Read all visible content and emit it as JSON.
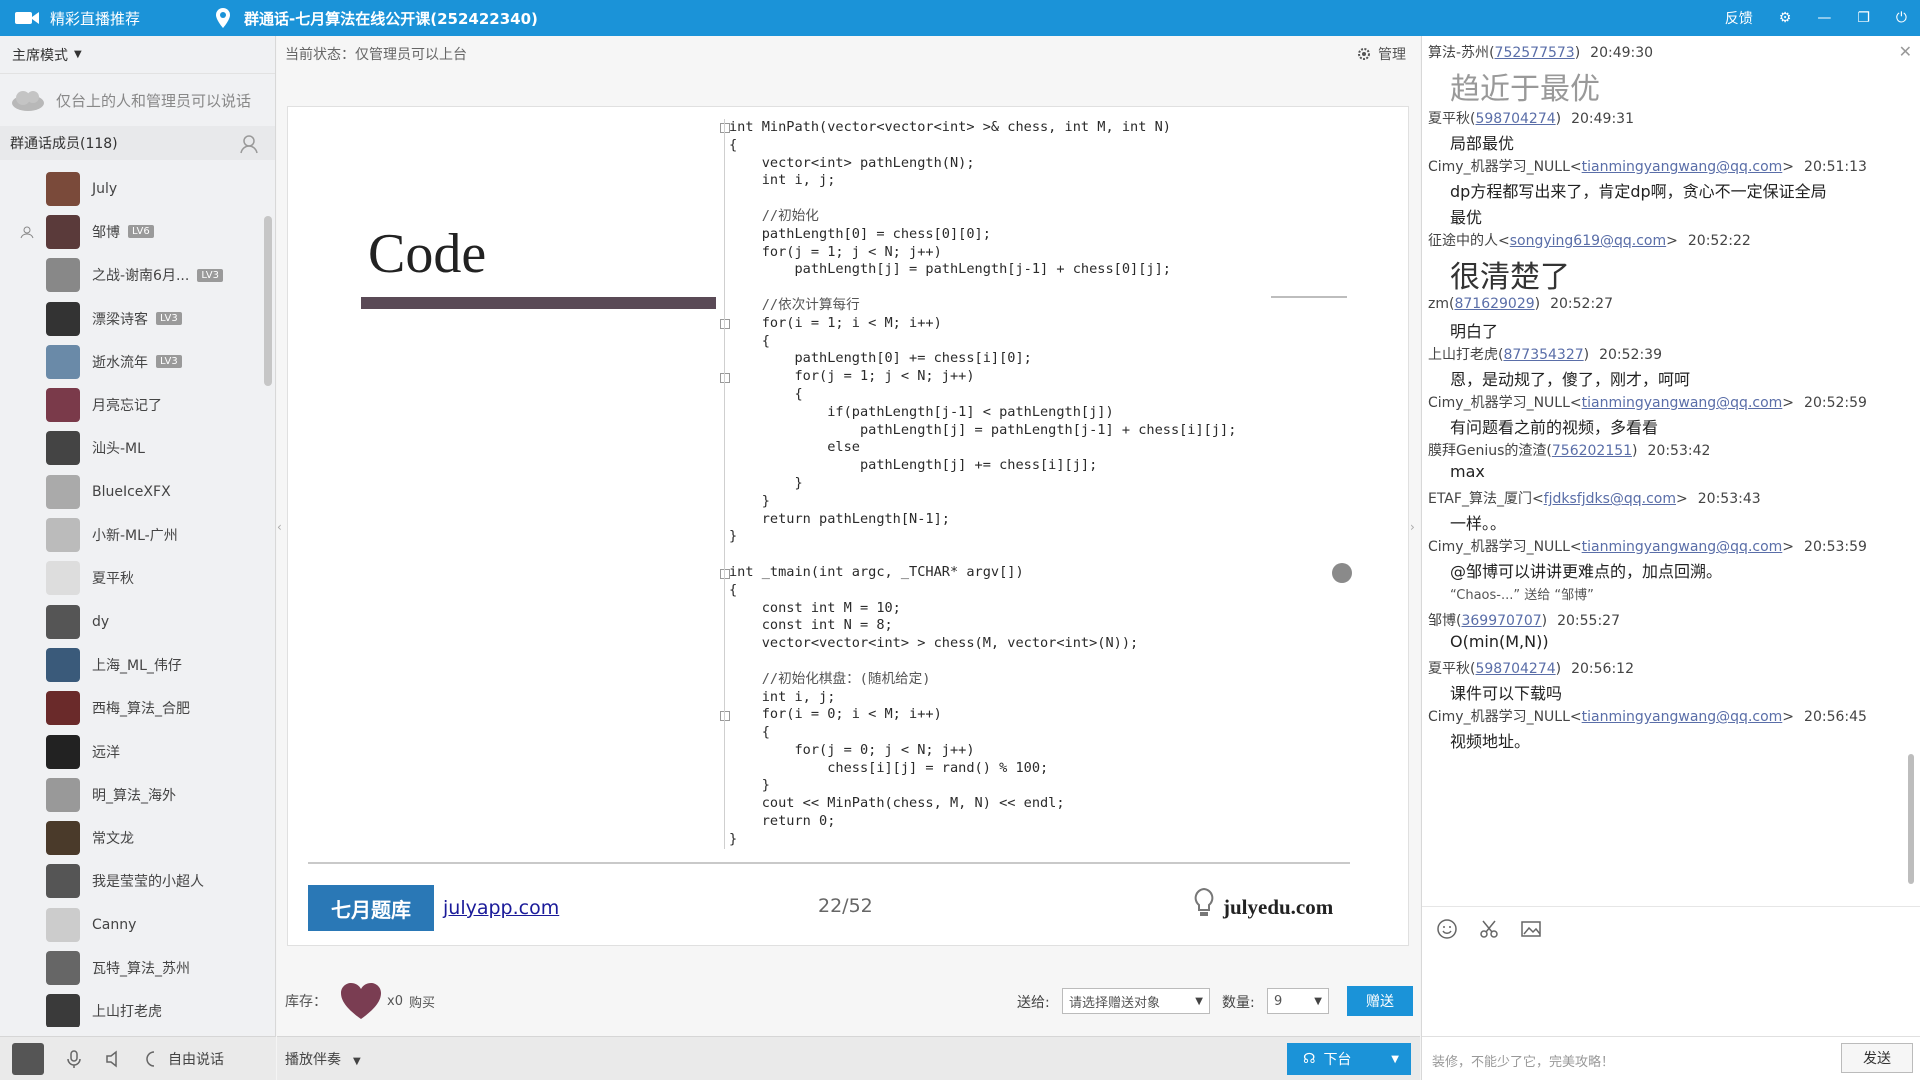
{
  "titlebar": {
    "app_label": "精彩直播推荐",
    "group_title": "群通话-七月算法在线公开课(252422340)",
    "feedback": "反馈",
    "controls": [
      "—",
      "❐",
      "⏻"
    ]
  },
  "left": {
    "mode": "主席模式",
    "notice": "仅台上的人和管理员可以说话",
    "members_header": "群通话成员(118)",
    "members": [
      {
        "name": "July",
        "badge": "",
        "color": "#7a4a3a"
      },
      {
        "name": "邹博",
        "badge": "LV6",
        "color": "#5a3a3a"
      },
      {
        "name": "之战-谢南6月...",
        "badge": "LV3",
        "color": "#888"
      },
      {
        "name": "漂梁诗客",
        "badge": "LV3",
        "color": "#333"
      },
      {
        "name": "逝水流年",
        "badge": "LV3",
        "color": "#6a8aa8"
      },
      {
        "name": "月亮忘记了",
        "badge": "",
        "color": "#7a3a4a"
      },
      {
        "name": "汕头-ML",
        "badge": "",
        "color": "#444"
      },
      {
        "name": "BlueIceXFX",
        "badge": "",
        "color": "#aaa"
      },
      {
        "name": "小新-ML-广州",
        "badge": "",
        "color": "#bbb"
      },
      {
        "name": "夏平秋",
        "badge": "",
        "color": "#ddd"
      },
      {
        "name": "dy",
        "badge": "",
        "color": "#555"
      },
      {
        "name": "上海_ML_伟仔",
        "badge": "",
        "color": "#3a5a7a"
      },
      {
        "name": "西梅_算法_合肥",
        "badge": "",
        "color": "#6a2a2a"
      },
      {
        "name": "远洋",
        "badge": "",
        "color": "#222"
      },
      {
        "name": "明_算法_海外",
        "badge": "",
        "color": "#999"
      },
      {
        "name": "常文龙",
        "badge": "",
        "color": "#4a3a2a"
      },
      {
        "name": "我是莹莹的小超人",
        "badge": "",
        "color": "#555"
      },
      {
        "name": "Canny",
        "badge": "",
        "color": "#ccc"
      },
      {
        "name": "瓦特_算法_苏州",
        "badge": "",
        "color": "#666"
      },
      {
        "name": "上山打老虎",
        "badge": "",
        "color": "#3a3a3a"
      }
    ],
    "bottom_free_talk": "自由说话"
  },
  "middle": {
    "status": "当前状态：仅管理员可以上台",
    "manage": "管理",
    "slide": {
      "title": "Code",
      "code_lines": [
        "int MinPath(vector<vector<int> >& chess, int M, int N)",
        "{",
        "    vector<int> pathLength(N);",
        "    int i, j;",
        "",
        "    //初始化",
        "    pathLength[0] = chess[0][0];",
        "    for(j = 1; j < N; j++)",
        "        pathLength[j] = pathLength[j-1] + chess[0][j];",
        "",
        "    //依次计算每行",
        "    for(i = 1; i < M; i++)",
        "    {",
        "        pathLength[0] += chess[i][0];",
        "        for(j = 1; j < N; j++)",
        "        {",
        "            if(pathLength[j-1] < pathLength[j])",
        "                pathLength[j] = pathLength[j-1] + chess[i][j];",
        "            else",
        "                pathLength[j] += chess[i][j];",
        "        }",
        "    }",
        "    return pathLength[N-1];",
        "}",
        "",
        "int _tmain(int argc, _TCHAR* argv[])",
        "{",
        "    const int M = 10;",
        "    const int N = 8;",
        "    vector<vector<int> > chess(M, vector<int>(N));",
        "",
        "    //初始化棋盘：(随机给定)",
        "    int i, j;",
        "    for(i = 0; i < M; i++)",
        "    {",
        "        for(j = 0; j < N; j++)",
        "            chess[i][j] = rand() % 100;",
        "    }",
        "    cout << MinPath(chess, M, N) << endl;",
        "    return 0;",
        "}"
      ],
      "logo_text": "七月题库",
      "july_link": "julyapp.com",
      "page": "22/52",
      "edu_link": "julyedu.com"
    },
    "gift": {
      "stock_label": "库存：",
      "count": "x0",
      "buy": "购买",
      "send_to_label": "送给:",
      "send_to_placeholder": "请选择赠送对象",
      "qty_label": "数量:",
      "qty_value": "9",
      "give_button": "赠送"
    },
    "bottom": {
      "bgm": "播放伴奏",
      "down_button": "下台"
    }
  },
  "chat": {
    "messages": [
      {
        "user": "算法-苏州",
        "uid": "752577573",
        "time": "20:49:30",
        "text": "趋近于最优",
        "big": true
      },
      {
        "user": "夏平秋",
        "uid": "598704274",
        "time": "20:49:31",
        "text": "局部最优"
      },
      {
        "user": "Cimy_机器学习_NULL<",
        "uid": "tianmingyangwang@qq.com",
        "suffix": ">",
        "time": "20:51:13",
        "text": "dp方程都写出来了，肯定dp啊，贪心不一定保证全局",
        "text2": "最优"
      },
      {
        "user": "征途中的人<",
        "uid": "songying619@qq.com",
        "suffix": ">",
        "time": "20:52:22",
        "text": "很清楚了",
        "big": true
      },
      {
        "user": "zm",
        "uid": "871629029",
        "time": "20:52:27",
        "text": "明白了"
      },
      {
        "user": "上山打老虎",
        "uid": "877354327",
        "time": "20:52:39",
        "text": "恩，是动规了，傻了，刚才，呵呵"
      },
      {
        "user": "Cimy_机器学习_NULL<",
        "uid": "tianmingyangwang@qq.com",
        "suffix": ">",
        "time": "20:52:59",
        "text": "有问题看之前的视频，多看看"
      },
      {
        "user": "膜拜Genius的渣渣",
        "uid": "756202151",
        "time": "20:53:42",
        "text": "max"
      },
      {
        "user": "ETAF_算法_厦门<",
        "uid": "fjdksfjdks@qq.com",
        "suffix": ">",
        "time": "20:53:43",
        "text": "一样。。"
      },
      {
        "user": "Cimy_机器学习_NULL<",
        "uid": "tianmingyangwang@qq.com",
        "suffix": ">",
        "time": "20:53:59",
        "text": "@邹博可以讲讲更难点的，加点回溯。"
      },
      {
        "user": "",
        "uid": "",
        "time": "",
        "text": "“Chaos-...” 送给 “邹博”",
        "gift": true
      },
      {
        "user": "邹博",
        "uid": "369970707",
        "time": "20:55:27",
        "text": "O(min(M,N))"
      },
      {
        "user": "夏平秋",
        "uid": "598704274",
        "time": "20:56:12",
        "text": "课件可以下载吗"
      },
      {
        "user": "Cimy_机器学习_NULL<",
        "uid": "tianmingyangwang@qq.com",
        "suffix": ">",
        "time": "20:56:45",
        "text": "视频地址。"
      }
    ],
    "tip": "装修，不能少了它，完美攻略！",
    "send_button": "发送"
  }
}
